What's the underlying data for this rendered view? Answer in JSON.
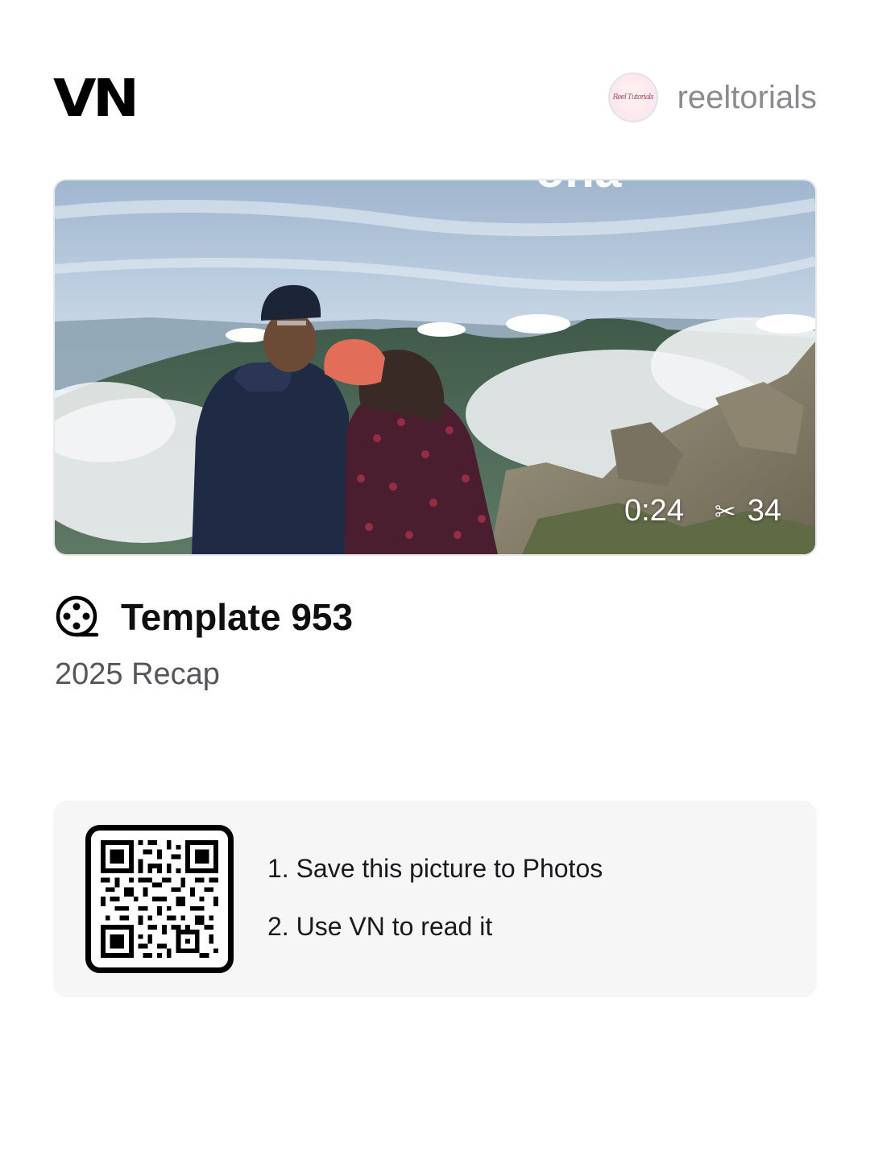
{
  "header": {
    "logo_text": "VN",
    "author_name": "reeltorials",
    "avatar_text": "Reel Tutorials"
  },
  "video": {
    "duration": "0:24",
    "clip_count": "34",
    "scissors_icon": "scissors-icon"
  },
  "template": {
    "icon": "film-reel-icon",
    "title": "Template 953",
    "subtitle": "2025 Recap"
  },
  "qr": {
    "icon": "qr-code",
    "steps": [
      "1. Save this picture to Photos",
      "2. Use VN to read it"
    ]
  }
}
